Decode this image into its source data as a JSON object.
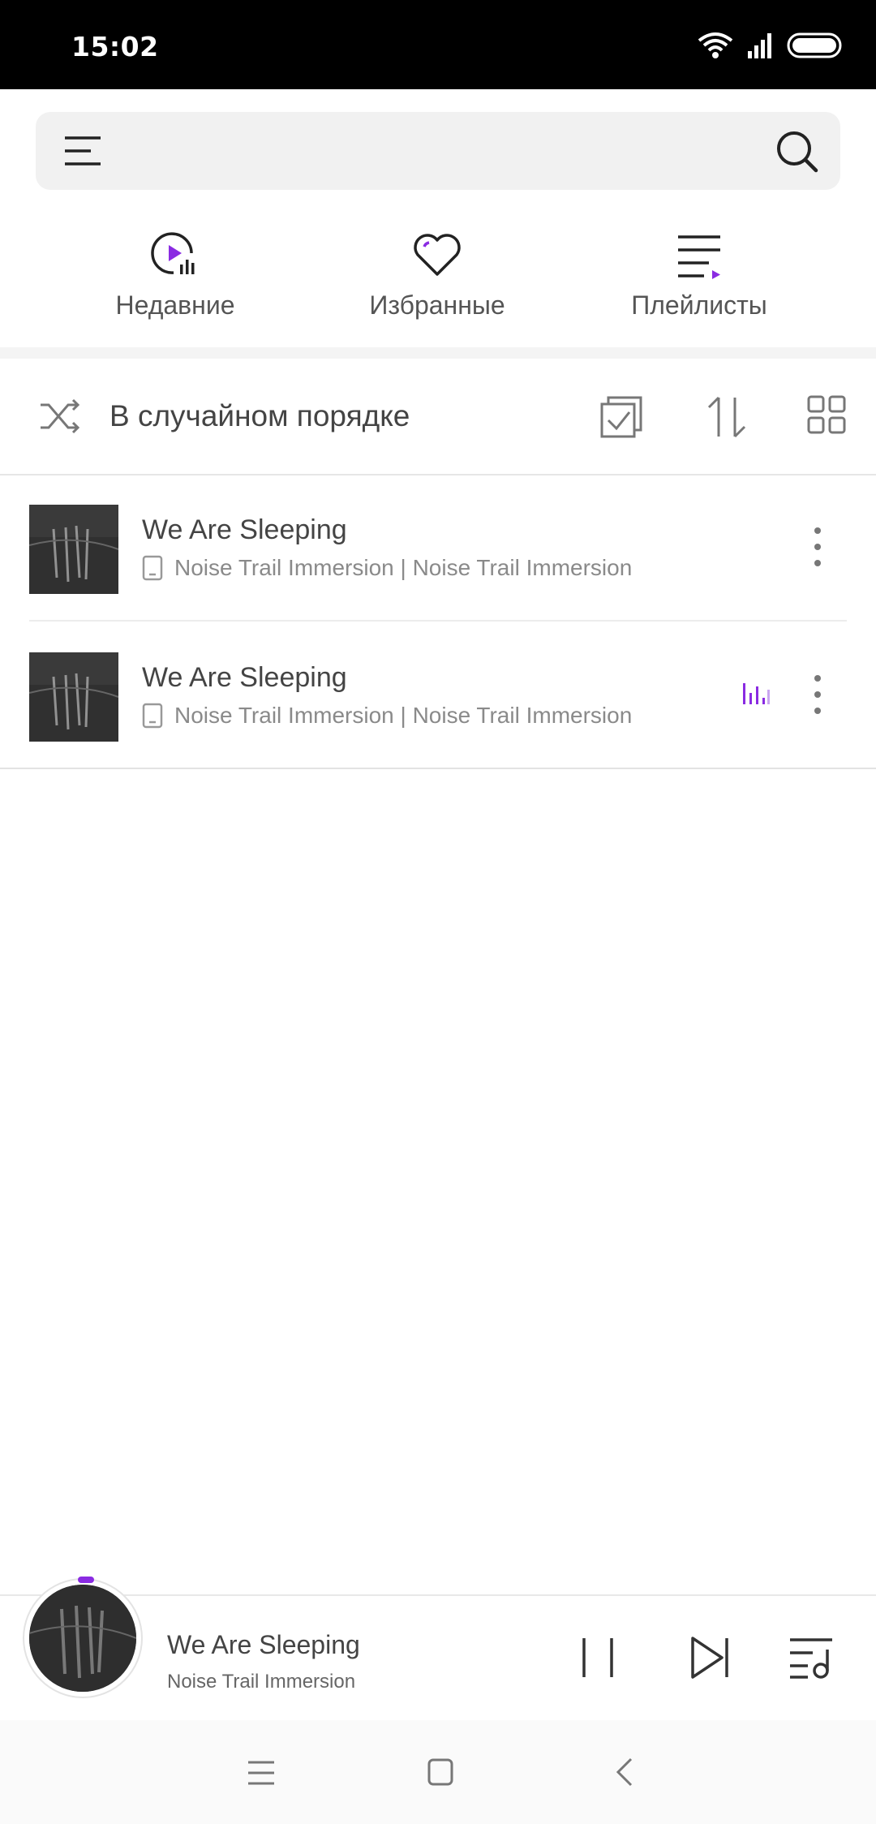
{
  "status_bar": {
    "time": "15:02"
  },
  "search": {
    "placeholder": ""
  },
  "quick_tabs": [
    {
      "label": "Недавние",
      "icon": "recent-play-icon"
    },
    {
      "label": "Избранные",
      "icon": "heart-icon"
    },
    {
      "label": "Плейлисты",
      "icon": "playlist-icon"
    }
  ],
  "toolbar": {
    "shuffle_label": "В случайном порядке",
    "icons": [
      "shuffle-icon",
      "multi-select-icon",
      "sort-icon",
      "grid-view-icon"
    ]
  },
  "songs": [
    {
      "title": "We Are Sleeping",
      "subtitle": "Noise Trail Immersion | Noise Trail Immersion",
      "playing": false
    },
    {
      "title": "We Are Sleeping",
      "subtitle": "Noise Trail Immersion | Noise Trail Immersion",
      "playing": true
    }
  ],
  "mini_player": {
    "title": "We Are Sleeping",
    "artist": "Noise Trail Immersion"
  },
  "colors": {
    "accent": "#8a2be2",
    "text": "#444444",
    "muted": "#8a8a8a"
  }
}
